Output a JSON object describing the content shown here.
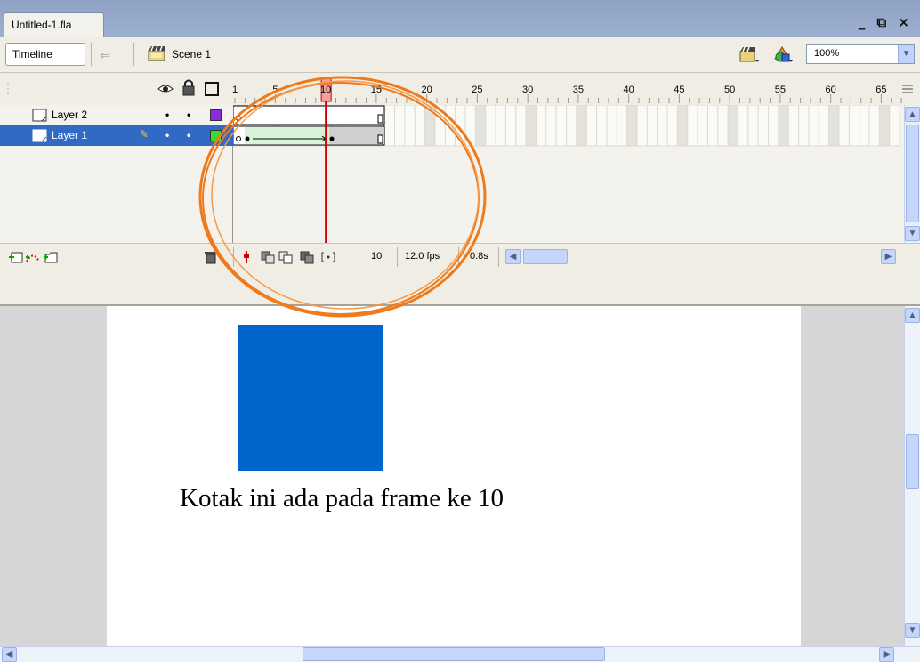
{
  "window": {
    "doc_tab": "Untitled-1.fla",
    "controls": "_ ⧉ ×"
  },
  "editbar": {
    "timeline_button": "Timeline",
    "scene_label": "Scene 1",
    "zoom_value": "100%"
  },
  "timeline": {
    "frame_numbers": [
      "1",
      "5",
      "10",
      "15",
      "20",
      "25",
      "30",
      "35",
      "40",
      "45",
      "50",
      "55",
      "60",
      "65"
    ],
    "current_frame": 10,
    "layers": [
      {
        "name": "Layer 2",
        "selected": false,
        "outline_color": "#8a2be2"
      },
      {
        "name": "Layer 1",
        "selected": true,
        "outline_color": "#33dd33"
      }
    ],
    "footer": {
      "current_frame": "10",
      "frame_rate": "12.0 fps",
      "elapsed_time": "0.8s"
    }
  },
  "stage": {
    "caption": "Kotak ini ada pada frame ke 10",
    "square_color": "#0066cc"
  },
  "colors": {
    "selection": "#316ac5",
    "playhead": "#cc0000",
    "annotation_circle": "#f07a1a"
  }
}
